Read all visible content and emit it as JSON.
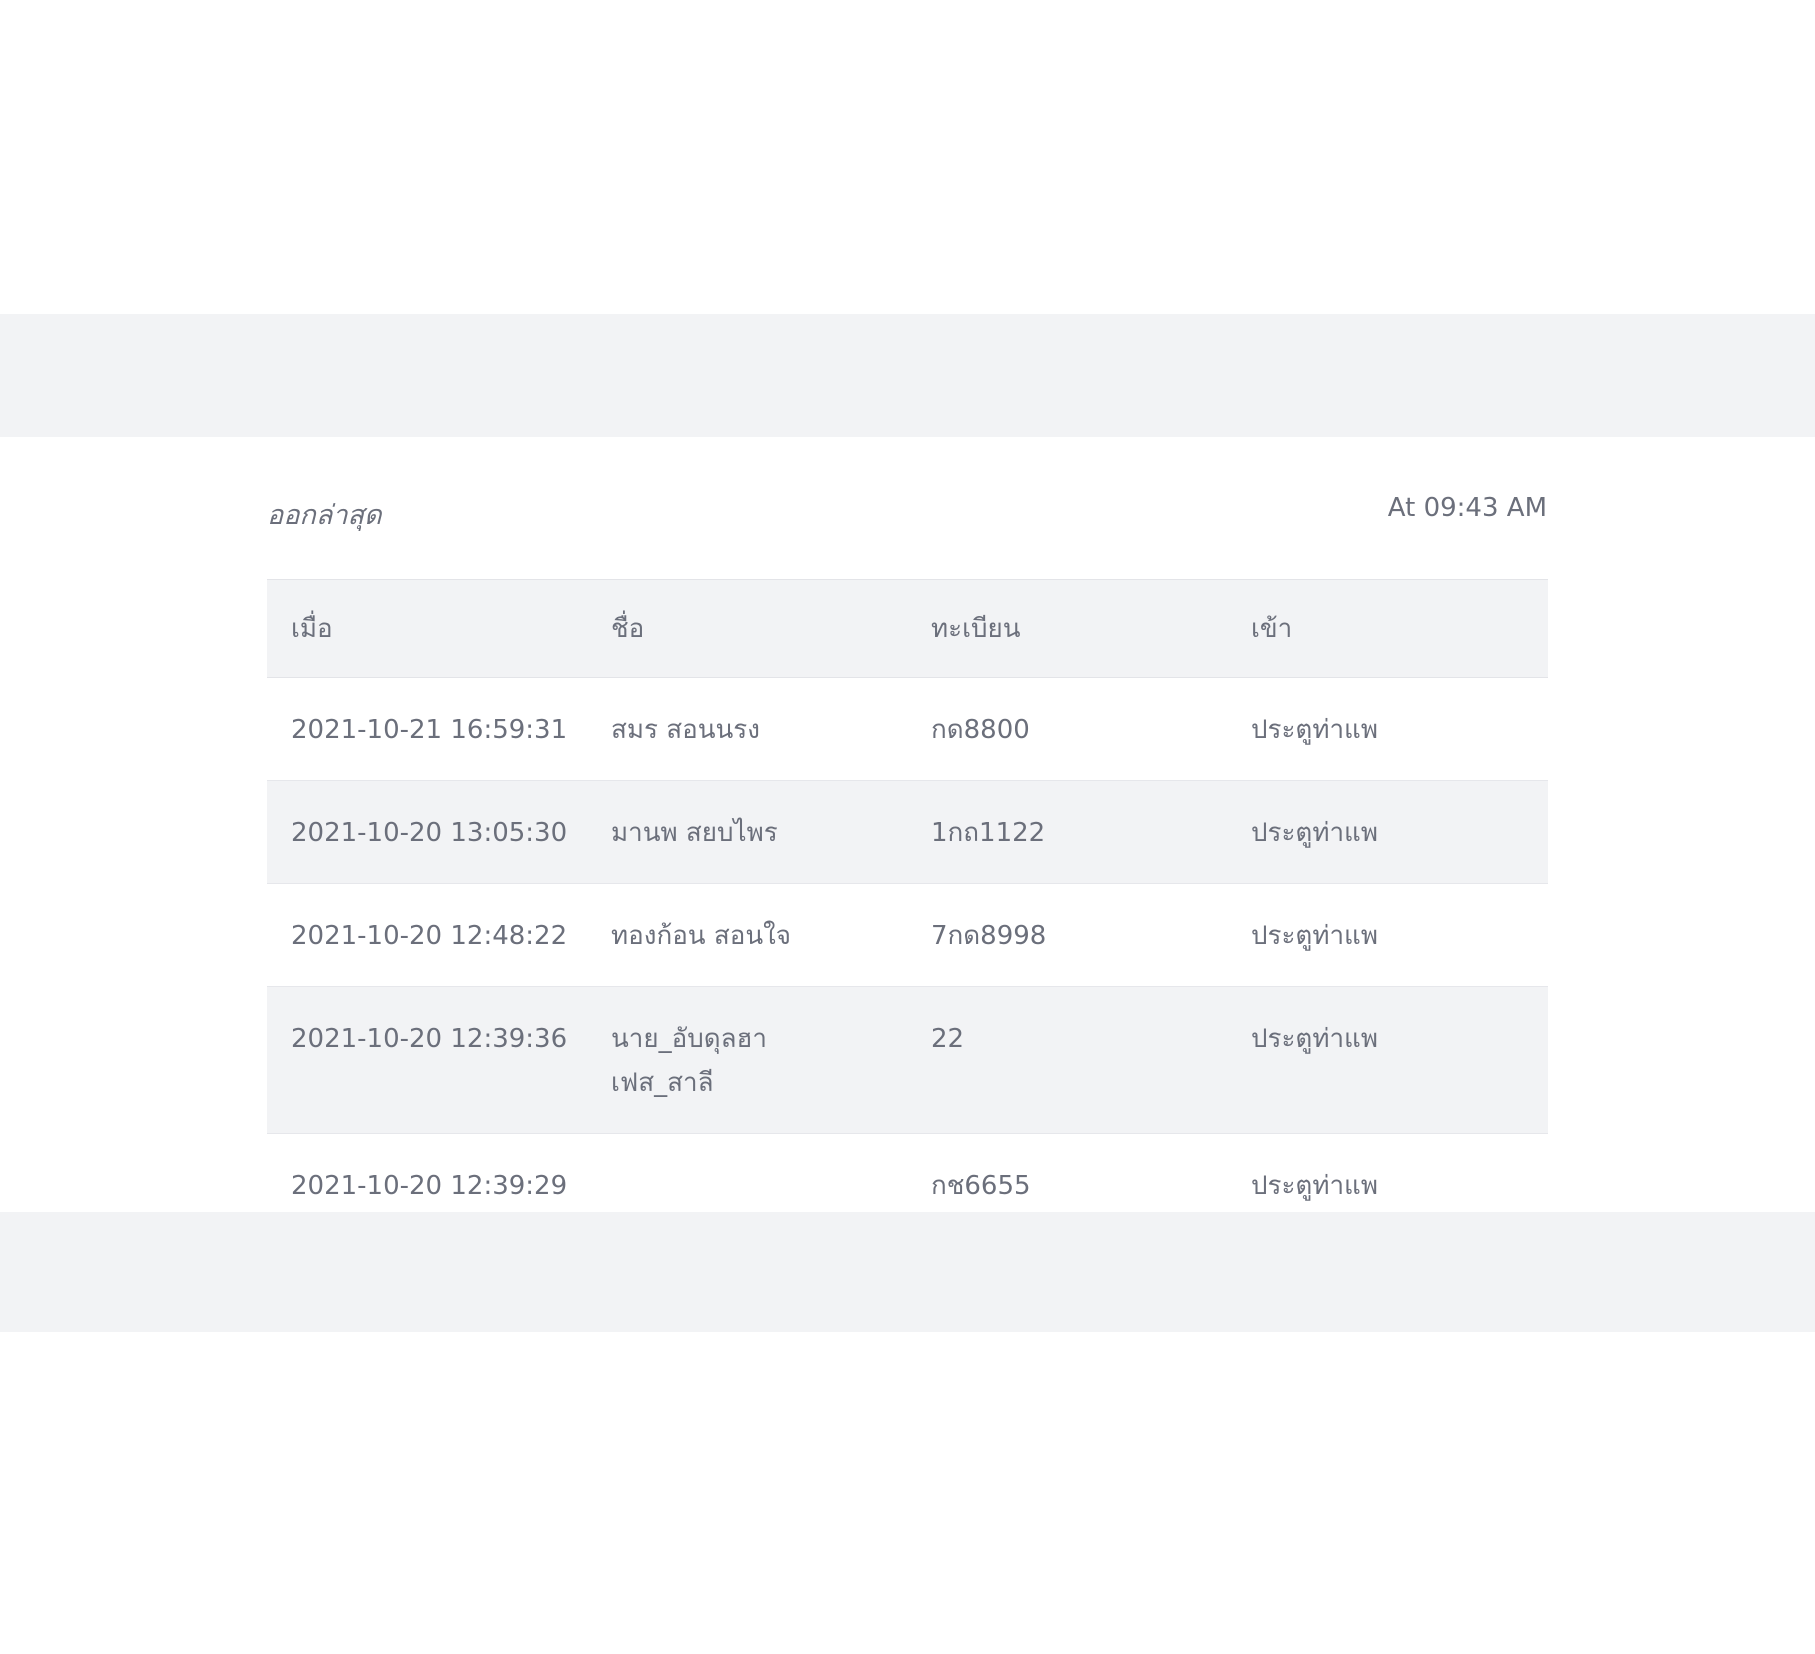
{
  "panel": {
    "title": "ออกล่าสุด",
    "time": "At 09:43 AM"
  },
  "table": {
    "headers": [
      "เมื่อ",
      "ชื่อ",
      "ทะเบียน",
      "เข้า"
    ],
    "rows": [
      {
        "when": "2021-10-21 16:59:31",
        "name": "สมร สอนนรง",
        "plate": "กด8800",
        "gate": "ประตูท่าแพ"
      },
      {
        "when": "2021-10-20 13:05:30",
        "name": "มานพ สยบไพร",
        "plate": "1กถ1122",
        "gate": "ประตูท่าแพ"
      },
      {
        "when": "2021-10-20 12:48:22",
        "name": "ทองก้อน สอนใจ",
        "plate": "7กด8998",
        "gate": "ประตูท่าแพ"
      },
      {
        "when": "2021-10-20 12:39:36",
        "name": "นาย_อับดุลฮา",
        "name_line2": "เฟส_สาลี",
        "plate": "22",
        "gate": "ประตูท่าแพ"
      },
      {
        "when": "2021-10-20 12:39:29",
        "name": "",
        "plate": "กช6655",
        "gate": "ประตูท่าแพ"
      }
    ]
  },
  "colors": {
    "band": "#f2f3f5",
    "card": "#ffffff",
    "text": "#6b6f7b",
    "row_alt": "#f2f3f5"
  }
}
